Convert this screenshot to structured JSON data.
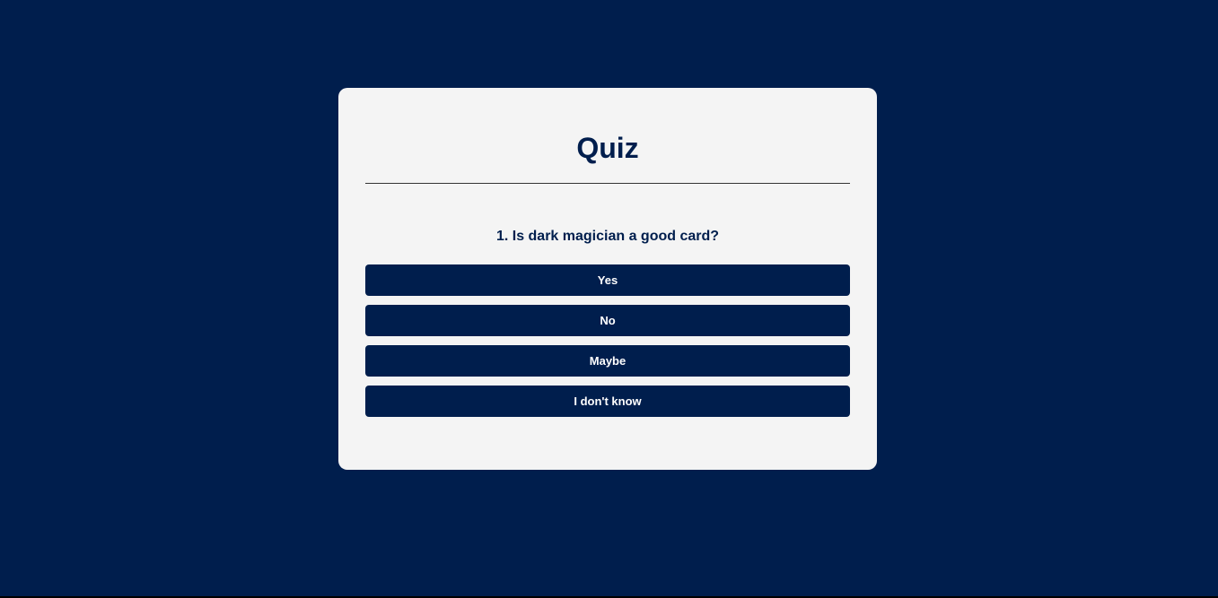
{
  "quiz": {
    "title": "Quiz",
    "question": "1. Is dark magician a good card?",
    "answers": [
      "Yes",
      "No",
      "Maybe",
      "I don't know"
    ]
  },
  "colors": {
    "background": "#001e4d",
    "card": "#f4f4f4",
    "accent": "#001e4d",
    "button_text": "#ffffff"
  }
}
